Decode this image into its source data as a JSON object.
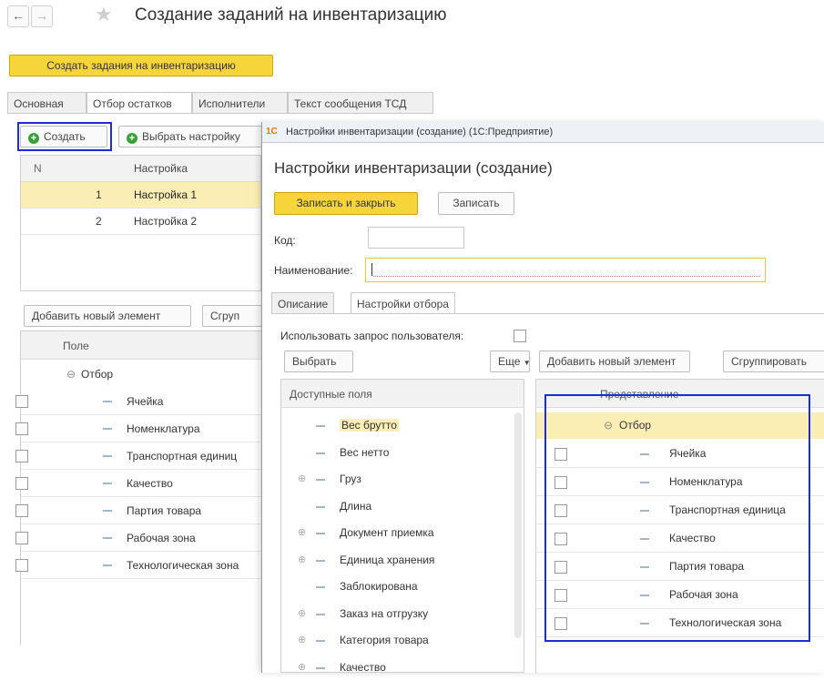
{
  "nav": {
    "back": "←",
    "forward": "→",
    "star": "★"
  },
  "page_title": "Создание заданий на инвентаризацию",
  "create_tasks_label": "Создать задания на инвентаризацию",
  "tabs": [
    "Основная",
    "Отбор остатков",
    "Исполнители",
    "Текст сообщения ТСД"
  ],
  "toolbar": {
    "create_label": "Создать",
    "choose_setting_label": "Выбрать настройку"
  },
  "settings_table": {
    "headers": {
      "n": "N",
      "setting": "Настройка"
    },
    "rows": [
      {
        "n": "1",
        "name": "Настройка 1"
      },
      {
        "n": "2",
        "name": "Настройка 2"
      }
    ]
  },
  "left_filter": {
    "add_label": "Добавить новый элемент",
    "group_label": "Сгруп",
    "field_header": "Поле",
    "root_label": "Отбор",
    "items": [
      "Ячейка",
      "Номенклатура",
      "Транспортная единиц",
      "Качество",
      "Партия товара",
      "Рабочая зона",
      "Технологическая зона"
    ]
  },
  "dialog": {
    "window_title": "Настройки инвентаризации (создание)  (1С:Предприятие)",
    "app_icon": "1С",
    "heading": "Настройки инвентаризации (создание)",
    "save_close_label": "Записать и закрыть",
    "save_label": "Записать",
    "code_label": "Код:",
    "code_value": "",
    "name_label": "Наименование:",
    "name_value": "",
    "tabs": [
      "Описание",
      "Настройки отбора"
    ],
    "use_query_label": "Использовать запрос пользователя:",
    "choose_label": "Выбрать",
    "more_label": "Еще",
    "available_header": "Доступные поля",
    "available_fields": [
      {
        "label": "Вес брутто",
        "expand": false
      },
      {
        "label": "Вес нетто",
        "expand": false
      },
      {
        "label": "Груз",
        "expand": true
      },
      {
        "label": "Длина",
        "expand": false
      },
      {
        "label": "Документ приемка",
        "expand": true
      },
      {
        "label": "Единица хранения",
        "expand": true
      },
      {
        "label": "Заблокирована",
        "expand": false
      },
      {
        "label": "Заказ на отгрузку",
        "expand": true
      },
      {
        "label": "Категория товара",
        "expand": true
      },
      {
        "label": "Качество",
        "expand": true
      }
    ],
    "add_element_label": "Добавить новый элемент",
    "group_label": "Сгруппировать",
    "repr_header": "Представление",
    "root_label": "Отбор",
    "filter_items": [
      "Ячейка",
      "Номенклатура",
      "Транспортная единица",
      "Качество",
      "Партия товара",
      "Рабочая зона",
      "Технологическая зона"
    ]
  }
}
